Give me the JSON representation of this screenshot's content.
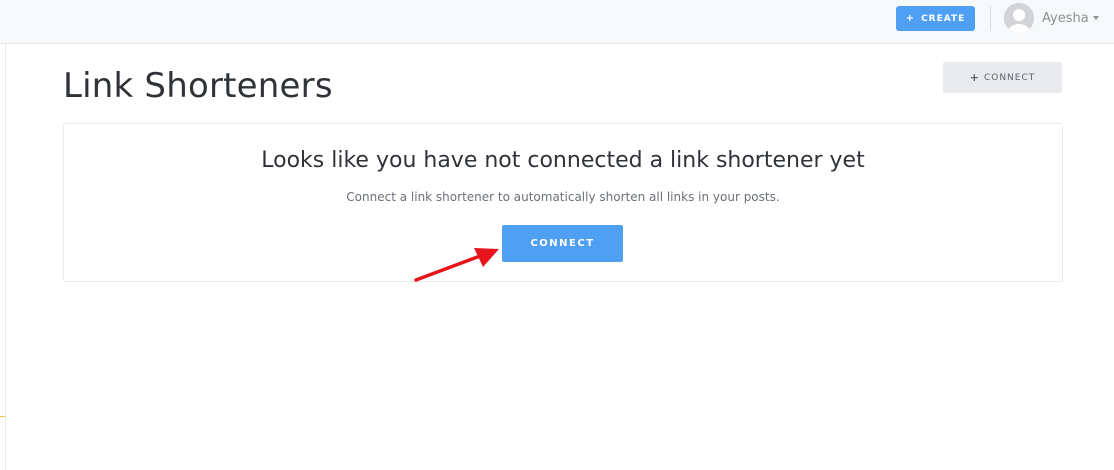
{
  "header": {
    "create_icon": "plus-icon",
    "create_label": "CREATE",
    "user": {
      "avatar_icon": "user-avatar-icon",
      "name": "Ayesha",
      "menu_icon": "caret-down-icon"
    }
  },
  "page": {
    "title": "Link Shorteners",
    "connect_icon": "plus-icon",
    "connect_label": "CONNECT"
  },
  "empty_state": {
    "heading": "Looks like you have not connected a link shortener yet",
    "description": "Connect a link shortener to automatically shorten all links in your posts.",
    "button_label": "CONNECT"
  },
  "annotation": {
    "icon": "red-arrow-icon",
    "color": "#e8141b"
  },
  "colors": {
    "accent": "#4f9ff5",
    "secondary_button": "#e8eaee",
    "topbar": "#f7f8fa"
  }
}
